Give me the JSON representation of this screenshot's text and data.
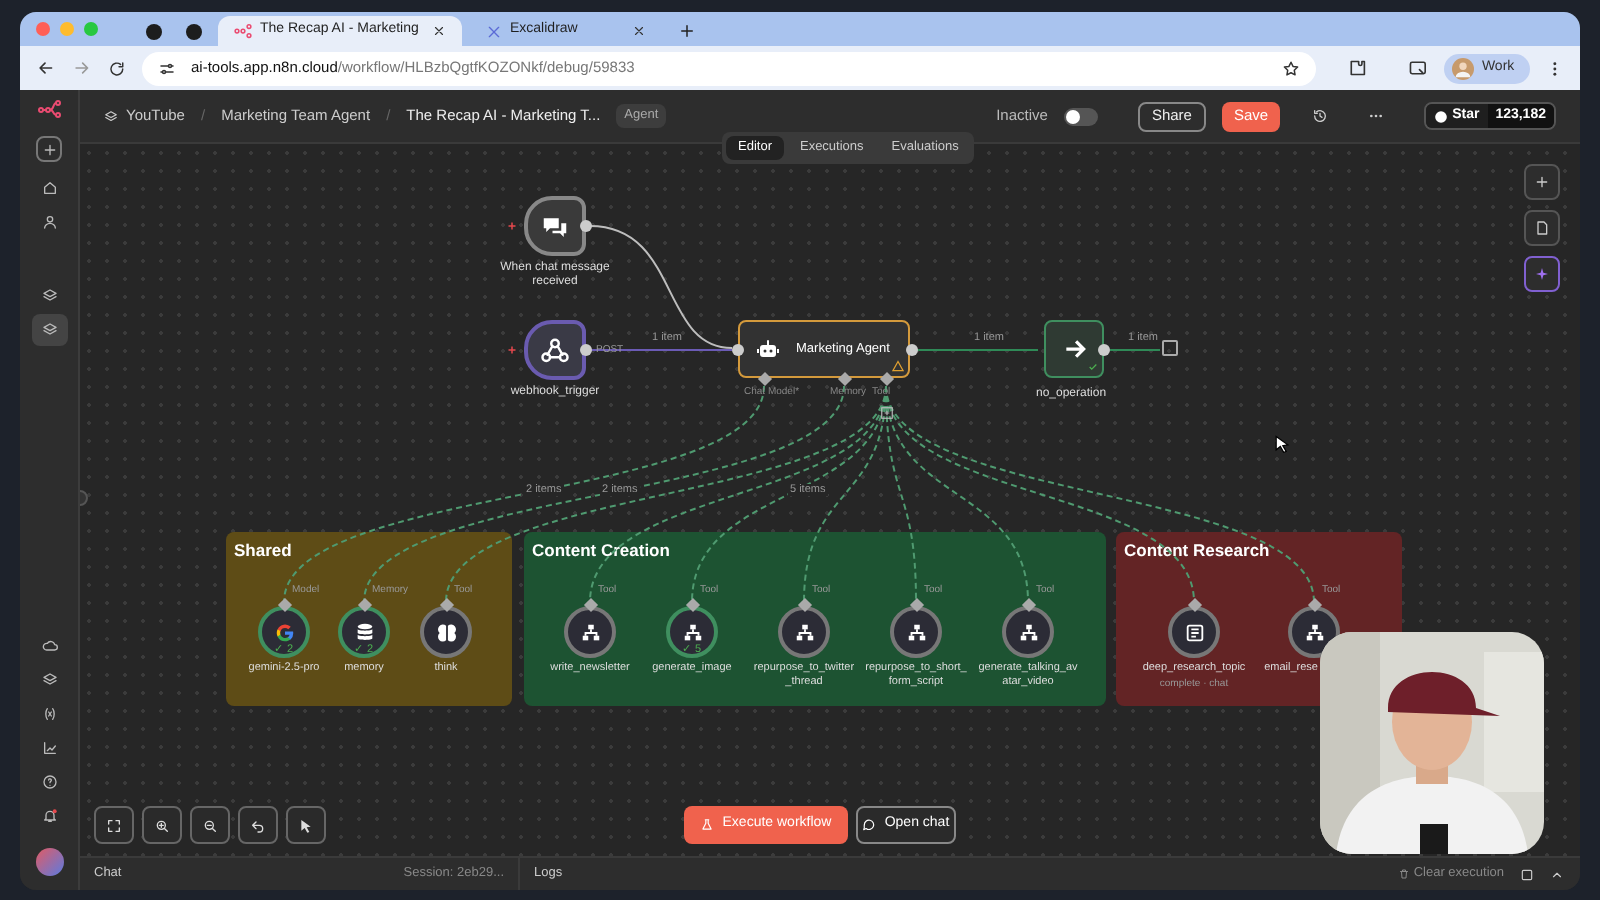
{
  "browser": {
    "tabs": [
      {
        "kind": "pinned",
        "selected": false
      },
      {
        "kind": "pinned",
        "selected": false
      },
      {
        "kind": "page",
        "title": "The Recap AI - Marketing",
        "selected": true
      },
      {
        "kind": "page",
        "title": "Excalidraw",
        "selected": false
      }
    ],
    "address_host": "ai-tools.app.n8n.cloud",
    "address_path": "/workflow/HLBzbQgtfKOZONkf/debug/59833",
    "profile": "Work"
  },
  "header": {
    "breadcrumbs": [
      "YouTube",
      "Marketing Team Agent",
      "The Recap AI - Marketing T..."
    ],
    "separators": [
      "/",
      "/"
    ],
    "tag": "Agent",
    "active_label": "Inactive",
    "active": false,
    "share": "Share",
    "save": "Save",
    "star_label": "Star",
    "star_count": "123,182"
  },
  "view_tabs": [
    {
      "label": "Editor",
      "selected": true
    },
    {
      "label": "Executions",
      "selected": false
    },
    {
      "label": "Evaluations",
      "selected": false
    }
  ],
  "triggers": [
    {
      "kind": "chat",
      "label": "When chat message received"
    },
    {
      "kind": "webhook",
      "label": "webhook_trigger",
      "output_label": "POST"
    }
  ],
  "agent": {
    "title": "Marketing Agent",
    "warning": true,
    "handles": [
      "Chat Model*",
      "Memory",
      "Tool"
    ]
  },
  "noop": {
    "label": "no_operation",
    "success": true
  },
  "connections": [
    {
      "label": "1 item"
    },
    {
      "label": "1 item"
    },
    {
      "label": "1 item"
    }
  ],
  "tool_links": [
    "2 items",
    "2 items",
    "5 items"
  ],
  "groups": [
    {
      "title": "Shared",
      "color": "#5e4c16",
      "tools": [
        {
          "kind": "google",
          "label": "gemini-2.5-pro",
          "handle": "Model",
          "badge": "✓ 2"
        },
        {
          "kind": "database",
          "label": "memory",
          "handle": "Memory",
          "badge": "✓ 2"
        },
        {
          "kind": "brain",
          "label": "think",
          "handle": "Tool"
        }
      ]
    },
    {
      "title": "Content Creation",
      "color": "#1d5332",
      "tools": [
        {
          "kind": "workflow",
          "label": "write_newsletter",
          "handle": "Tool"
        },
        {
          "kind": "workflow",
          "label": "generate_image",
          "handle": "Tool",
          "badge": "✓ 5"
        },
        {
          "kind": "workflow",
          "label": "repurpose_to_twitter_thread",
          "handle": "Tool"
        },
        {
          "kind": "workflow",
          "label": "repurpose_to_short_form_script",
          "handle": "Tool"
        },
        {
          "kind": "workflow",
          "label": "generate_talking_avatar_video",
          "handle": "Tool"
        }
      ]
    },
    {
      "title": "Content Research",
      "color": "#632425",
      "tools": [
        {
          "kind": "research",
          "label": "deep_research_topic",
          "sublabel": "complete · chat"
        },
        {
          "kind": "workflow",
          "label": "email_rese",
          "handle": "Tool"
        }
      ]
    }
  ],
  "execute": "Execute workflow",
  "open_chat": "Open chat",
  "bottom_panel": {
    "chat": "Chat",
    "session": "Session: 2eb29...",
    "logs": "Logs",
    "clear": "Clear execution"
  },
  "webcam": {
    "kind": "picture"
  }
}
